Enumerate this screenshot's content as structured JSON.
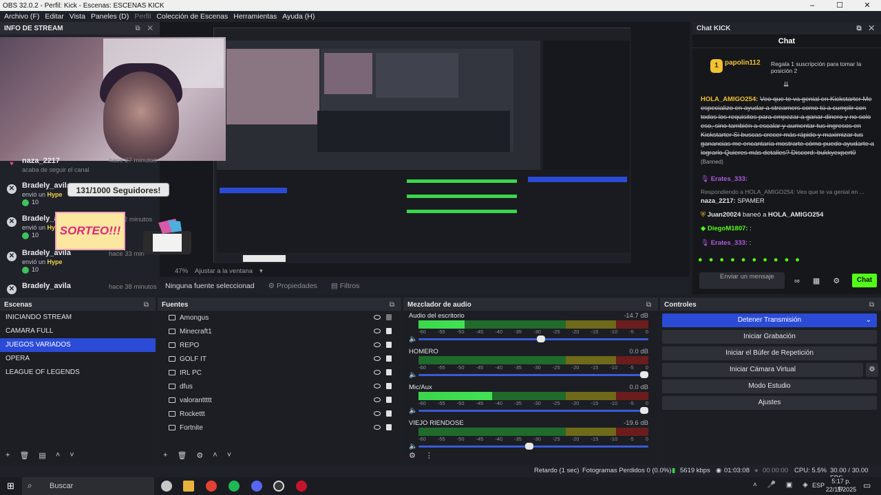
{
  "window": {
    "title": "OBS 32.0.2 - Perfil: Kick - Escenas: ESCENAS KICK"
  },
  "menu": [
    "Archivo (F)",
    "Editar",
    "Vista",
    "Paneles (D)",
    "Perfil",
    "Colección de Escenas",
    "Herramientas",
    "Ayuda (H)"
  ],
  "info_stream": {
    "title": "INFO DE STREAM",
    "first_event": {
      "name": "naza_2217",
      "action": "acaba de seguir el canal",
      "time": "hace 27 minutos"
    },
    "events": [
      {
        "name": "Bradely_avila",
        "action_prefix": "envió un",
        "action_highlight": "Hype",
        "amount": "10",
        "time": ""
      },
      {
        "name": "Bradely_av",
        "action_prefix": "envió un",
        "action_highlight": "Hype",
        "amount": "10",
        "time": "2 minutos"
      },
      {
        "name": "Bradely_avila",
        "action_prefix": "envió un",
        "action_highlight": "Hype",
        "amount": "10",
        "time": "hace 33 min"
      },
      {
        "name": "Bradely_avila",
        "action_prefix": "",
        "action_highlight": "",
        "amount": "",
        "time": "hace 38 minutos"
      }
    ],
    "follower_goal": "131/1000 Seguidores!",
    "sorteo": "SORTEO!!!"
  },
  "preview": {
    "zoom": "47%",
    "fit": "Ajustar a la ventana",
    "no_source": "Ninguna fuente seleccionad",
    "properties": "Propiedades",
    "filters": "Filtros"
  },
  "chat": {
    "dock_title": "Chat KICK",
    "tab": "Chat",
    "pinned": {
      "user": "papolin112",
      "badge_num": "1",
      "text": "Regala 1 suscripción para tomar la posición 2"
    },
    "messages": [
      {
        "user": "HOLA_AMIGO254:",
        "text": "Veo que te va genial en Kickstarter Me especializo en ayudar a streamers como tú a cumplir con todos los requisitos para empezar a ganar dinero y no solo eso, sino también a escalar y aumentar tus ingresos en Kickstarter Si buscas crecer más rápido y maximizar tus ganancias me encantaría mostrarte cómo puedo ayudarte a lograrlo Quieres más detalles? Discord: bukkyexpert0",
        "note": "(Banned)"
      },
      {
        "user": "Erates_333:",
        "text": ""
      },
      {
        "user": "",
        "text": "Respondiendo a HOLA_AMIGO254: Veo que te va genial en ..."
      },
      {
        "user": "naza_2217:",
        "text": "SPAMER"
      },
      {
        "user": "Juan20024",
        "text": "baneó a",
        "target": "HOLA_AMIGO254"
      },
      {
        "user": "DiegoM1807:",
        "text": ":"
      },
      {
        "user": "Erates_333:",
        "text": ":"
      }
    ],
    "input_placeholder": "Enviar un mensaje",
    "send_label": "Chat"
  },
  "scenes": {
    "title": "Escenas",
    "items": [
      "INICIANDO STREAM",
      "CAMARA FULL",
      "JUEGOS VARIADOS",
      "OPERA",
      "LEAGUE OF LEGENDS"
    ],
    "selected": "JUEGOS VARIADOS"
  },
  "sources": {
    "title": "Fuentes",
    "items": [
      "Amongus",
      "Minecraft1",
      "REPO",
      "GOLF IT",
      "IRL PC",
      "dfus",
      "valoranttttt",
      "Rockettt",
      "Fortnite"
    ]
  },
  "mixer": {
    "title": "Mezclador de audio",
    "scale": [
      "-60",
      "-55",
      "-50",
      "-45",
      "-40",
      "-35",
      "-30",
      "-25",
      "-20",
      "-15",
      "-10",
      "-5",
      "0"
    ],
    "channels": [
      {
        "name": "Audio del escritorio",
        "db": "-14.7 dB",
        "level": 0.2,
        "fader": 0.55
      },
      {
        "name": "HOMERO",
        "db": "0.0 dB",
        "level": 0.0,
        "fader": 1.0
      },
      {
        "name": "Mic/Aux",
        "db": "0.0 dB",
        "level": 0.32,
        "fader": 1.0
      },
      {
        "name": "VIEJO RIENDOSE",
        "db": "-19.6 dB",
        "level": 0.0,
        "fader": 0.5
      }
    ]
  },
  "controls": {
    "title": "Controles",
    "buttons": [
      "Detener Transmisión",
      "Iniciar Grabación",
      "Iniciar el Búfer de Repetición",
      "Iniciar Cámara Virtual",
      "Modo Estudio",
      "Ajustes"
    ]
  },
  "status": {
    "delay": "Retardo (1 sec)",
    "dropped": "Fotogramas Perdidos 0 (0.0%)",
    "bitrate": "5619 kbps",
    "stream_time": "01:03:08",
    "rec_time": "00:00:00",
    "cpu": "CPU: 5.5%",
    "fps": "30.00 / 30.00 FPS"
  },
  "taskbar": {
    "search": "Buscar",
    "lang": "ESP",
    "time": "5:17 p. m.",
    "date": "22/11/2025"
  },
  "colors": {
    "accent": "#2b4bd6",
    "kick_green": "#53fc18",
    "meter_green": "#3bd64b"
  }
}
